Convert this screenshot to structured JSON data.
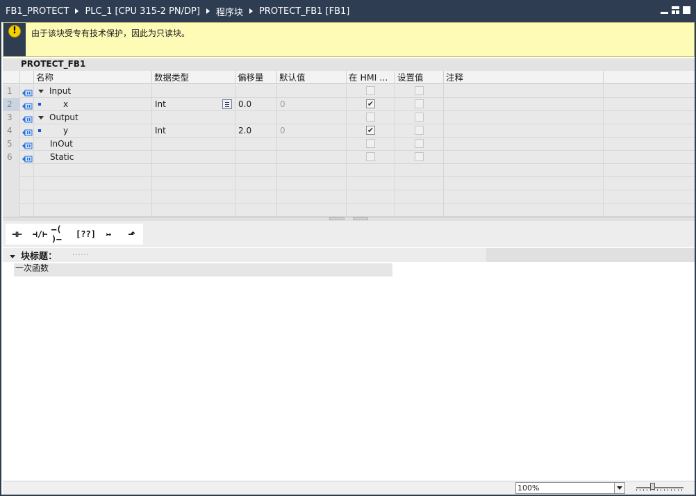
{
  "titlebar": {
    "crumbs": [
      "FB1_PROTECT",
      "PLC_1 [CPU 315-2 PN/DP]",
      "程序块",
      "PROTECT_FB1 [FB1]"
    ]
  },
  "warning": {
    "icon": "warning-exclamation-icon",
    "text": "由于该块受专有技术保护，因此为只读块。"
  },
  "block": {
    "name": "PROTECT_FB1"
  },
  "table": {
    "headers": [
      "名称",
      "数据类型",
      "偏移量",
      "默认值",
      "在 HMI ...",
      "设置值",
      "注释"
    ],
    "rows": [
      {
        "num": "1",
        "name": "Input",
        "type": "",
        "offset": "",
        "default": "",
        "hmi": false,
        "setpoint": false,
        "section": true
      },
      {
        "num": "2",
        "name": "x",
        "type": "Int",
        "offset": "0.0",
        "default": "0",
        "hmi": true,
        "setpoint": false,
        "section": false
      },
      {
        "num": "3",
        "name": "Output",
        "type": "",
        "offset": "",
        "default": "",
        "hmi": false,
        "setpoint": false,
        "section": true
      },
      {
        "num": "4",
        "name": "y",
        "type": "Int",
        "offset": "2.0",
        "default": "0",
        "hmi": true,
        "setpoint": false,
        "section": false
      },
      {
        "num": "5",
        "name": "InOut",
        "type": "",
        "offset": "",
        "default": "",
        "hmi": false,
        "setpoint": false,
        "section": false
      },
      {
        "num": "6",
        "name": "Static",
        "type": "",
        "offset": "",
        "default": "",
        "hmi": false,
        "setpoint": false,
        "section": false
      }
    ]
  },
  "ladder_toolbar": {
    "buttons": [
      {
        "label": "⊣⊢",
        "icon": "no-contact-icon"
      },
      {
        "label": "⊣/⊢",
        "icon": "nc-contact-icon"
      },
      {
        "label": "–( )–",
        "icon": "coil-icon"
      },
      {
        "label": "[??]",
        "icon": "empty-box-icon"
      },
      {
        "label": "↦",
        "icon": "open-branch-icon"
      },
      {
        "label": "⬏",
        "icon": "close-branch-icon"
      }
    ]
  },
  "network": {
    "title_label": "块标题：",
    "title_placeholder": "......",
    "comment": "一次函数"
  },
  "statusbar": {
    "zoom": "100%",
    "zoom_slider_level": 0.33
  }
}
